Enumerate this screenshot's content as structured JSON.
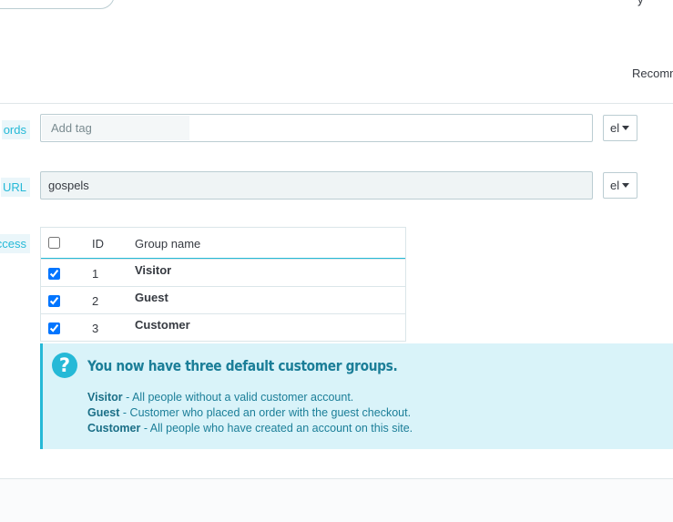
{
  "header": {
    "top_right_mark": "y",
    "recommend_label": "Recomm"
  },
  "form": {
    "tags": {
      "label": "ords",
      "placeholder": "Add tag",
      "lang": "el"
    },
    "friendly_url": {
      "label": "URL",
      "value": "gospels",
      "lang": "el"
    },
    "group_access": {
      "label": "ccess",
      "columns": [
        "",
        "ID",
        "Group name"
      ],
      "rows": [
        {
          "id": "1",
          "name": "Visitor",
          "checked": true
        },
        {
          "id": "2",
          "name": "Guest",
          "checked": true
        },
        {
          "id": "3",
          "name": "Customer",
          "checked": true
        }
      ]
    }
  },
  "alert": {
    "icon": "question-icon",
    "title": "You now have three default customer groups.",
    "lines": [
      {
        "strong": "Visitor",
        "text": " - All people without a valid customer account."
      },
      {
        "strong": "Guest",
        "text": " - Customer who placed an order with the guest checkout."
      },
      {
        "strong": "Customer",
        "text": " - All people who have created an account on this site."
      }
    ]
  },
  "colors": {
    "accent": "#25b9d7",
    "alert_bg": "#d9f3f9",
    "alert_text": "#1b7e98",
    "text": "#363a41",
    "border": "#bbcdd2"
  }
}
